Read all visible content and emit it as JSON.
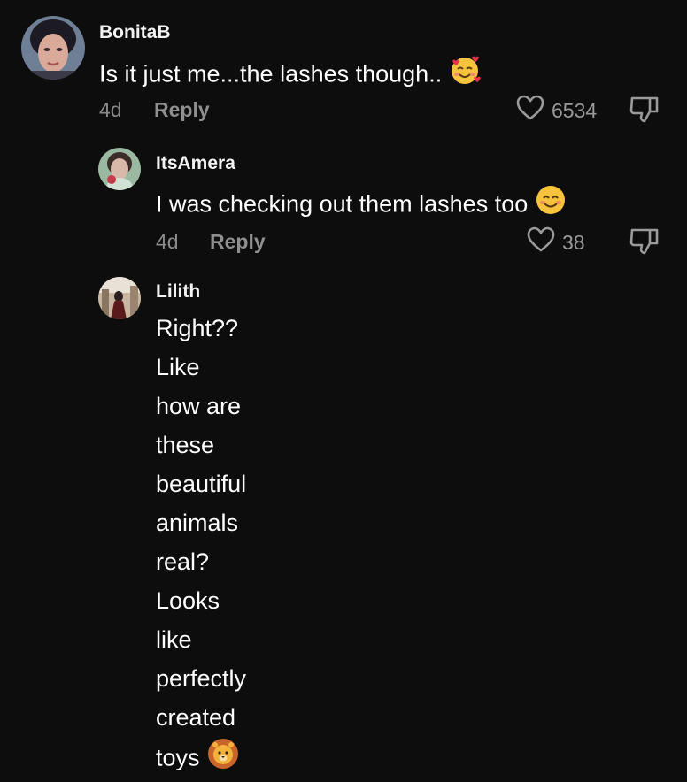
{
  "comments": [
    {
      "username": "BonitaB",
      "text": "Is it just me...the lashes though..",
      "emoji": "smiling-face-with-hearts",
      "age": "4d",
      "reply_label": "Reply",
      "likes": "6534"
    },
    {
      "username": "ItsAmera",
      "text": "I was checking out them lashes too",
      "emoji": "smiling-face",
      "age": "4d",
      "reply_label": "Reply",
      "likes": "38"
    },
    {
      "username": "Lilith",
      "text_line1": "Right?? Like how are these beautiful",
      "text_line2": "animals real? Looks like perfectly created",
      "text_line3": "toys",
      "emoji": "lion-face"
    }
  ],
  "colors": {
    "background": "#0d0d0d",
    "muted": "#8a8a8a",
    "text": "#ffffff"
  }
}
